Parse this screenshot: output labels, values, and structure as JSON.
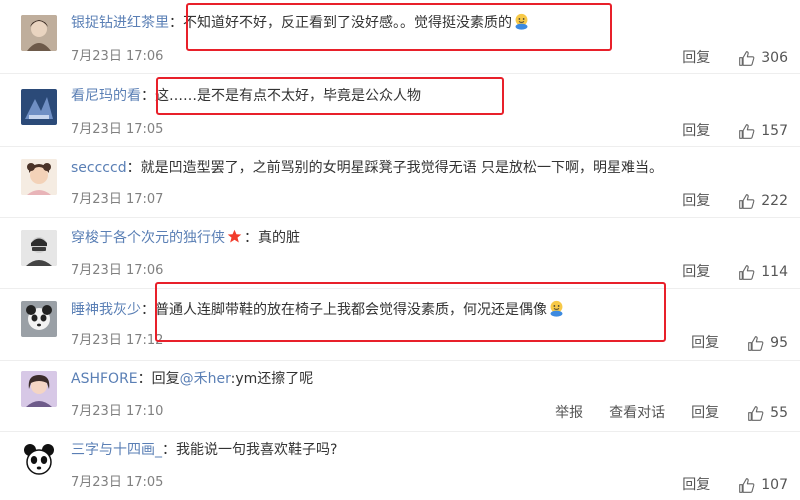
{
  "reply_label": "回复",
  "report_label": "举报",
  "view_thread_label": "查看对话",
  "colors": {
    "username": "#5a7fb5",
    "highlight": "#e8202a",
    "time": "#808080"
  },
  "comments": [
    {
      "username": "银捉钻进红茶里",
      "sep": "：",
      "text": "不知道好不好，反正看到了没好感。。觉得挺没素质的",
      "emoji": "doge-icon",
      "time": "7月23日 17:06",
      "likes": "306"
    },
    {
      "username": "看尼玛的看",
      "sep": "：",
      "text": "这……是不是有点不太好，毕竟是公众人物",
      "time": "7月23日 17:05",
      "likes": "157"
    },
    {
      "username": "seccccd",
      "sep": "：",
      "text": "就是凹造型罢了，之前骂别的女明星踩凳子我觉得无语 只是放松一下啊，明星难当。",
      "time": "7月23日 17:07",
      "likes": "222"
    },
    {
      "username": "穿梭于各个次元的独行侠",
      "badge": "star-icon",
      "sep": "：",
      "text": "真的脏",
      "time": "7月23日 17:06",
      "likes": "114"
    },
    {
      "username": "睡神我灰少",
      "sep": "：",
      "text": "普通人连脚带鞋的放在椅子上我都会觉得没素质，何况还是偶像",
      "emoji": "doge-icon",
      "time": "7月23日 17:12",
      "likes": "95"
    },
    {
      "username": "ASHFORE",
      "sep": "：",
      "reply_prefix": "回复",
      "mention": "@禾her",
      "text": ":ym还擦了呢",
      "time": "7月23日 17:10",
      "likes": "55"
    },
    {
      "username": "三字与十四画_",
      "sep": "：",
      "text": "我能说一句我喜欢鞋子吗?",
      "time": "7月23日 17:05",
      "likes": "107"
    }
  ]
}
